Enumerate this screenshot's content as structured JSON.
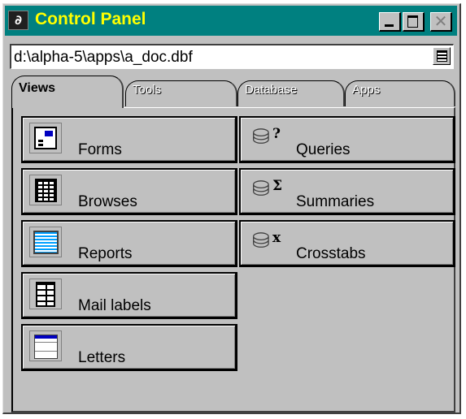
{
  "window": {
    "title": "Control Panel",
    "close_glyph": "✕",
    "app_icon_glyph": "∂"
  },
  "path": {
    "value": "d:\\alpha-5\\apps\\a_doc.dbf"
  },
  "tabs": [
    {
      "label": "Views",
      "active": true
    },
    {
      "label": "Tools",
      "active": false
    },
    {
      "label": "Database",
      "active": false
    },
    {
      "label": "Apps",
      "active": false
    }
  ],
  "items_left": [
    {
      "label": "Forms",
      "icon": "form-icon"
    },
    {
      "label": "Browses",
      "icon": "browse-icon"
    },
    {
      "label": "Reports",
      "icon": "report-icon"
    },
    {
      "label": "Mail labels",
      "icon": "mail-labels-icon"
    },
    {
      "label": "Letters",
      "icon": "letter-icon"
    }
  ],
  "items_right": [
    {
      "label": "Queries",
      "icon": "query-icon",
      "glyph": "⛁",
      "suffix": "?"
    },
    {
      "label": "Summaries",
      "icon": "summary-icon",
      "glyph": "⛁",
      "suffix": "Σ"
    },
    {
      "label": "Crosstabs",
      "icon": "crosstab-icon",
      "glyph": "⛁",
      "suffix": "x"
    }
  ],
  "colors": {
    "titlebar": "#008080",
    "title_text": "#ffff00",
    "face": "#c0c0c0"
  }
}
